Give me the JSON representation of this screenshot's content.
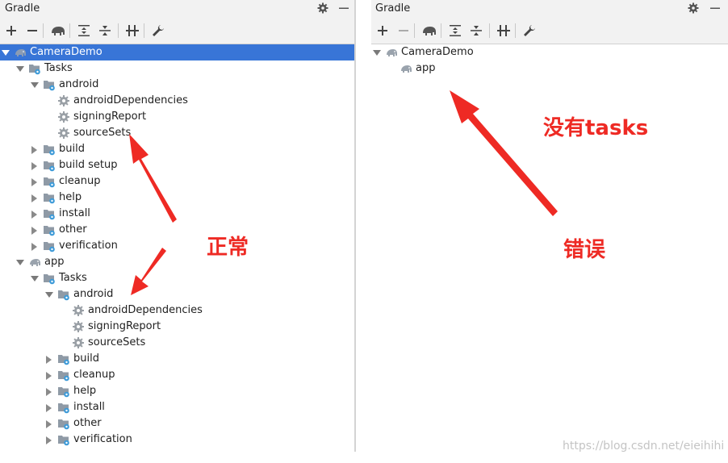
{
  "left_panel": {
    "title": "Gradle",
    "toolbar": [
      "add-icon",
      "remove-icon",
      "gradle-elephant-icon",
      "expand-all-icon",
      "collapse-all-icon",
      "toggle-offline-icon",
      "wrench-icon"
    ],
    "rows": [
      {
        "label": "CameraDemo",
        "icon": "gradle-elephant-icon",
        "expander": "open",
        "selected": true
      },
      {
        "label": "Tasks",
        "icon": "task-folder-icon",
        "expander": "open"
      },
      {
        "label": "android",
        "icon": "task-folder-icon",
        "expander": "open"
      },
      {
        "label": "androidDependencies",
        "icon": "gear-icon",
        "expander": "none"
      },
      {
        "label": "signingReport",
        "icon": "gear-icon",
        "expander": "none"
      },
      {
        "label": "sourceSets",
        "icon": "gear-icon",
        "expander": "none"
      },
      {
        "label": "build",
        "icon": "task-folder-icon",
        "expander": "closed"
      },
      {
        "label": "build setup",
        "icon": "task-folder-icon",
        "expander": "closed"
      },
      {
        "label": "cleanup",
        "icon": "task-folder-icon",
        "expander": "closed"
      },
      {
        "label": "help",
        "icon": "task-folder-icon",
        "expander": "closed"
      },
      {
        "label": "install",
        "icon": "task-folder-icon",
        "expander": "closed"
      },
      {
        "label": "other",
        "icon": "task-folder-icon",
        "expander": "closed"
      },
      {
        "label": "verification",
        "icon": "task-folder-icon",
        "expander": "closed"
      },
      {
        "label": "app",
        "icon": "gradle-elephant-icon",
        "expander": "open"
      },
      {
        "label": "Tasks",
        "icon": "task-folder-icon",
        "expander": "open"
      },
      {
        "label": "android",
        "icon": "task-folder-icon",
        "expander": "open"
      },
      {
        "label": "androidDependencies",
        "icon": "gear-icon",
        "expander": "none"
      },
      {
        "label": "signingReport",
        "icon": "gear-icon",
        "expander": "none"
      },
      {
        "label": "sourceSets",
        "icon": "gear-icon",
        "expander": "none"
      },
      {
        "label": "build",
        "icon": "task-folder-icon",
        "expander": "closed"
      },
      {
        "label": "cleanup",
        "icon": "task-folder-icon",
        "expander": "closed"
      },
      {
        "label": "help",
        "icon": "task-folder-icon",
        "expander": "closed"
      },
      {
        "label": "install",
        "icon": "task-folder-icon",
        "expander": "closed"
      },
      {
        "label": "other",
        "icon": "task-folder-icon",
        "expander": "closed"
      },
      {
        "label": "verification",
        "icon": "task-folder-icon",
        "expander": "closed"
      }
    ]
  },
  "right_panel": {
    "title": "Gradle",
    "toolbar": [
      "add-icon",
      "remove-icon",
      "gradle-elephant-icon",
      "expand-all-icon",
      "collapse-all-icon",
      "toggle-offline-icon",
      "wrench-icon"
    ],
    "rows": [
      {
        "label": "CameraDemo",
        "icon": "gradle-elephant-icon",
        "expander": "open"
      },
      {
        "label": "app",
        "icon": "gradle-elephant-icon",
        "expander": "none"
      }
    ]
  },
  "annotations": {
    "normal": "正常",
    "error": "错误",
    "no_tasks": "没有tasks"
  },
  "watermark": "https://blog.csdn.net/eieihihi",
  "colors": {
    "selection": "#3875d7",
    "annotation": "#ee2a24",
    "folder": "#8f9aa6",
    "gear": "#9aa0a6",
    "badge": "#3d9ad8"
  }
}
